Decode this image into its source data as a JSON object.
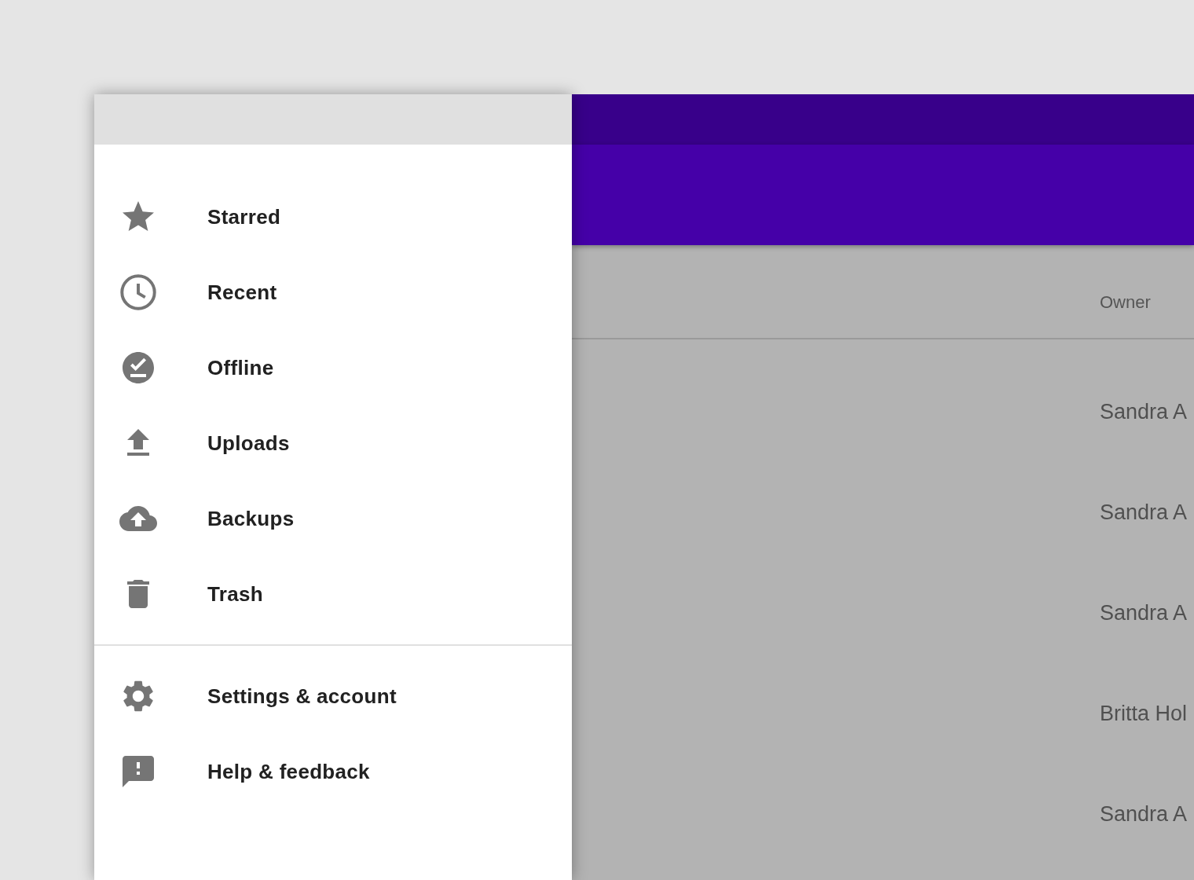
{
  "drawer": {
    "sections": [
      {
        "items": [
          {
            "kind": "starred",
            "label": "Starred"
          },
          {
            "kind": "recent",
            "label": "Recent"
          },
          {
            "kind": "offline",
            "label": "Offline"
          },
          {
            "kind": "uploads",
            "label": "Uploads"
          },
          {
            "kind": "backups",
            "label": "Backups"
          },
          {
            "kind": "trash",
            "label": "Trash"
          }
        ]
      },
      {
        "items": [
          {
            "kind": "settings",
            "label": "Settings & account"
          },
          {
            "kind": "help",
            "label": "Help & feedback"
          }
        ]
      }
    ]
  },
  "table": {
    "columns": [
      "Owner"
    ],
    "rows": [
      {
        "owner": "Sandra A"
      },
      {
        "owner": "Sandra A"
      },
      {
        "owner": "Sandra A"
      },
      {
        "owner": "Britta Hol"
      },
      {
        "owner": "Sandra A"
      }
    ]
  }
}
